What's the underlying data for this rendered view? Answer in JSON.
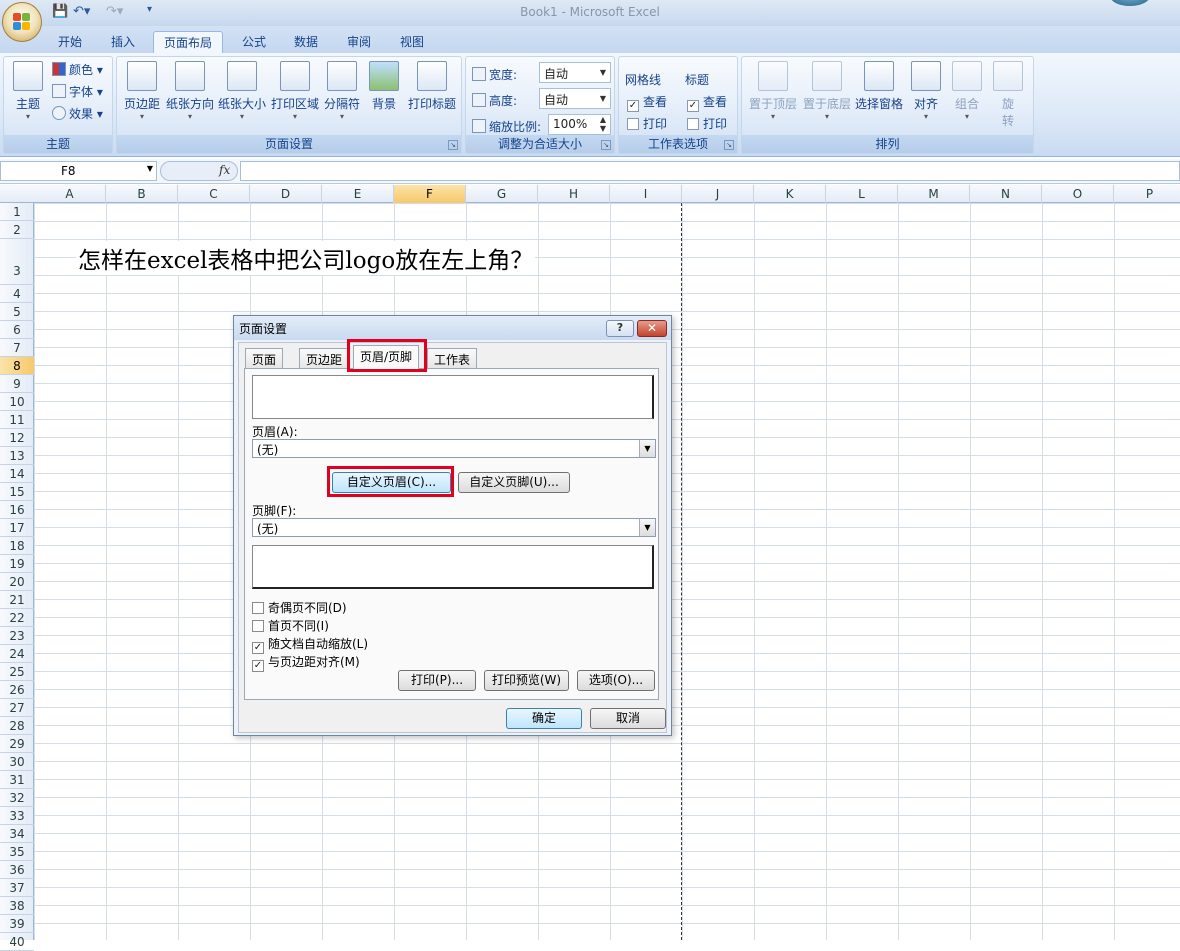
{
  "window": {
    "title": "Book1 - Microsoft Excel"
  },
  "tabs": [
    "开始",
    "插入",
    "页面布局",
    "公式",
    "数据",
    "审阅",
    "视图"
  ],
  "active_tab": "页面布局",
  "ribbon": {
    "theme": {
      "label": "主题",
      "themes_btn": "主题",
      "colors": "颜色",
      "fonts": "字体",
      "effects": "效果"
    },
    "page_setup": {
      "label": "页面设置",
      "margins": "页边距",
      "orientation": "纸张方向",
      "size": "纸张大小",
      "print_area": "打印区域",
      "breaks": "分隔符",
      "background": "背景",
      "print_titles": "打印标题"
    },
    "scale": {
      "label": "调整为合适大小",
      "width_label": "宽度:",
      "width_value": "自动",
      "height_label": "高度:",
      "height_value": "自动",
      "scale_label": "缩放比例:",
      "scale_value": "100%"
    },
    "sheet_options": {
      "label": "工作表选项",
      "gridlines": "网格线",
      "headings": "标题",
      "view": "查看",
      "print": "打印"
    },
    "arrange": {
      "label": "排列",
      "bring_front": "置于顶层",
      "send_back": "置于底层",
      "selection_pane": "选择窗格",
      "align": "对齐",
      "group": "组合",
      "rotate_1": "旋",
      "rotate_2": "转"
    }
  },
  "formula_bar": {
    "name_box": "F8",
    "fx": "fx",
    "content": ""
  },
  "columns": [
    "A",
    "B",
    "C",
    "D",
    "E",
    "F",
    "G",
    "H",
    "I",
    "J",
    "K",
    "L",
    "M",
    "N",
    "O",
    "P"
  ],
  "selected_column": "F",
  "rows": [
    "1",
    "2",
    "3",
    "4",
    "5",
    "6",
    "7",
    "8",
    "9",
    "10",
    "11",
    "12",
    "13",
    "14",
    "15",
    "16",
    "17",
    "18",
    "19",
    "20",
    "21",
    "22",
    "23",
    "24",
    "25",
    "26",
    "27",
    "28",
    "29",
    "30",
    "31",
    "32",
    "33",
    "34",
    "35",
    "36",
    "37",
    "38",
    "39",
    "40"
  ],
  "selected_row": "8",
  "cells": {
    "B3": "怎样在excel表格中把公司logo放在左上角？"
  },
  "dialog": {
    "title": "页面设置",
    "help": "?",
    "close": "✕",
    "tabs": [
      "页面",
      "页边距",
      "页眉/页脚",
      "工作表"
    ],
    "active_tab": "页眉/页脚",
    "header_label": "页眉(A):",
    "header_value": "(无)",
    "custom_header": "自定义页眉(C)...",
    "custom_footer": "自定义页脚(U)...",
    "footer_label": "页脚(F):",
    "footer_value": "(无)",
    "options": [
      {
        "label": "奇偶页不同(D)",
        "checked": false
      },
      {
        "label": "首页不同(I)",
        "checked": false
      },
      {
        "label": "随文档自动缩放(L)",
        "checked": true
      },
      {
        "label": "与页边距对齐(M)",
        "checked": true
      }
    ],
    "print": "打印(P)...",
    "print_preview": "打印预览(W)",
    "options_btn": "选项(O)...",
    "ok": "确定",
    "cancel": "取消"
  },
  "colors": {
    "highlight_red": "#e00020",
    "selected_header": "#f8c86b",
    "ribbon_text": "#15428b"
  }
}
